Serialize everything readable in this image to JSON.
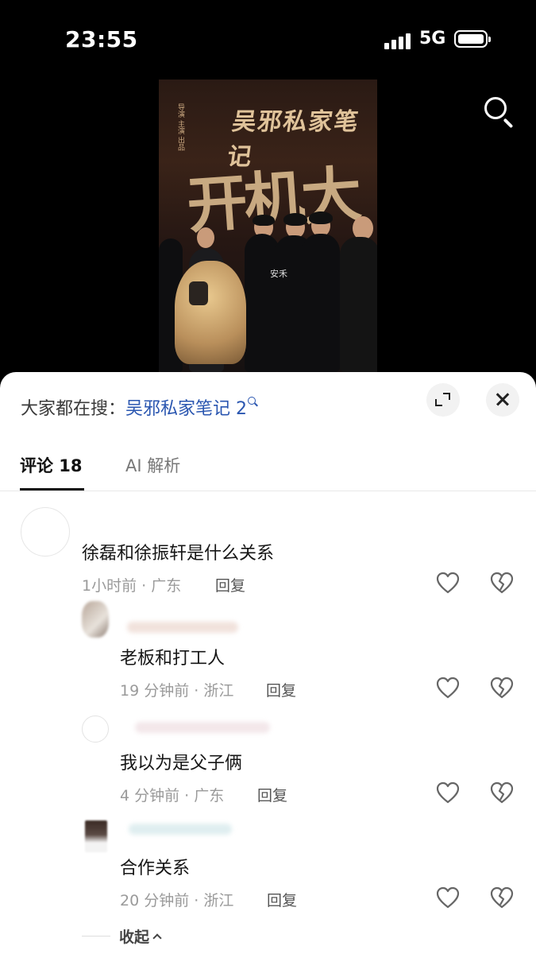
{
  "status_bar": {
    "time": "23:55",
    "network": "5G",
    "battery_level": 0.9
  },
  "video": {
    "poster_title": "吴邪私家笔记",
    "poster_big_text": "开机大",
    "poster_side_text": "导演 主演 出品",
    "watermark": "安禾"
  },
  "sheet": {
    "hot_search_prefix": "大家都在搜：",
    "hot_search_query": "吴邪私家笔记 2",
    "tabs": [
      {
        "label": "评论 18",
        "active": true
      },
      {
        "label": "AI 解析",
        "active": false
      }
    ]
  },
  "comments": [
    {
      "text": "徐磊和徐振轩是什么关系",
      "meta": "1小时前 · 广东",
      "reply_label": "回复"
    },
    {
      "text": "老板和打工人",
      "meta": "19 分钟前 · 浙江",
      "reply_label": "回复"
    },
    {
      "text": "我以为是父子俩",
      "meta": "4 分钟前 · 广东",
      "reply_label": "回复"
    },
    {
      "text": "合作关系",
      "meta": "20 分钟前 · 浙江",
      "reply_label": "回复"
    }
  ],
  "collapse_label": "收起",
  "colors": {
    "link": "#2a56b0",
    "text": "#161616",
    "meta": "#9a9a9a",
    "background": "#ffffff"
  },
  "icons": [
    "search-icon",
    "expand-icon",
    "close-icon",
    "heart-icon",
    "broken-heart-icon",
    "chevron-up-icon"
  ]
}
